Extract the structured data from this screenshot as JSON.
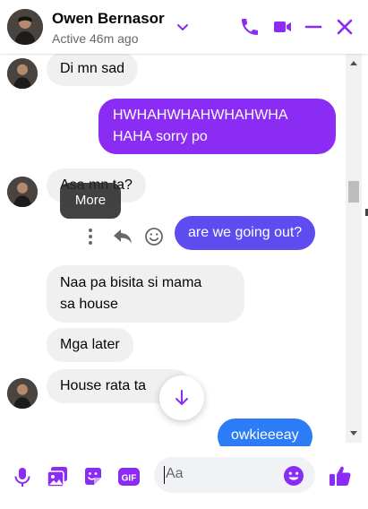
{
  "header": {
    "name": "Owen Bernasor",
    "status": "Active 46m ago",
    "icons": [
      "chevron-down-icon",
      "phone-icon",
      "video-icon",
      "minimize-icon",
      "close-icon"
    ]
  },
  "colors": {
    "accent": "#8b2cf5",
    "incoming_bubble": "#f0f0f0",
    "blue_bubble": "#2b7cf5"
  },
  "messages": {
    "m1": "Di mn sad",
    "m2a": "HWHAHWHAHWHAHWHA",
    "m2b": "HAHA sorry po",
    "m3": "Asa mn ta?",
    "m4": "are we going out?",
    "m5a": "Naa pa bisita si mama",
    "m5b": "sa house",
    "m6": "Mga later",
    "m7": "House rata ta",
    "m8": "owkieeeay"
  },
  "tooltip": "More",
  "composer": {
    "placeholder": "Aa",
    "icons": [
      "microphone-icon",
      "image-icon",
      "sticker-icon",
      "gif-icon",
      "emoji-icon",
      "thumbs-up-icon"
    ]
  }
}
